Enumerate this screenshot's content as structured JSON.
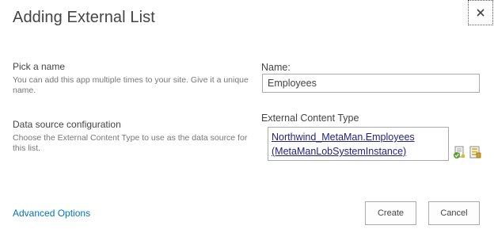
{
  "dialog": {
    "title": "Adding External List",
    "close_icon": "close-icon"
  },
  "name_section": {
    "title": "Pick a name",
    "description": "You can add this app multiple times to your site. Give it a unique name.",
    "field_label": "Name:",
    "field_value": "Employees"
  },
  "datasource_section": {
    "title": "Data source configuration",
    "description": "Choose the External Content Type to use as the data source for this list.",
    "field_label": "External Content Type",
    "ect_line1": "Northwind_MetaMan.Employees",
    "ect_line2": "(MetaManLobSystemInstance)",
    "icons": [
      "check-names-icon",
      "browse-content-types-icon"
    ]
  },
  "footer": {
    "advanced_options": "Advanced Options",
    "create_label": "Create",
    "cancel_label": "Cancel"
  },
  "colors": {
    "text": "#444444",
    "muted": "#777777",
    "link": "#0072c6",
    "ect_link": "#222288",
    "border": "#ababab"
  }
}
